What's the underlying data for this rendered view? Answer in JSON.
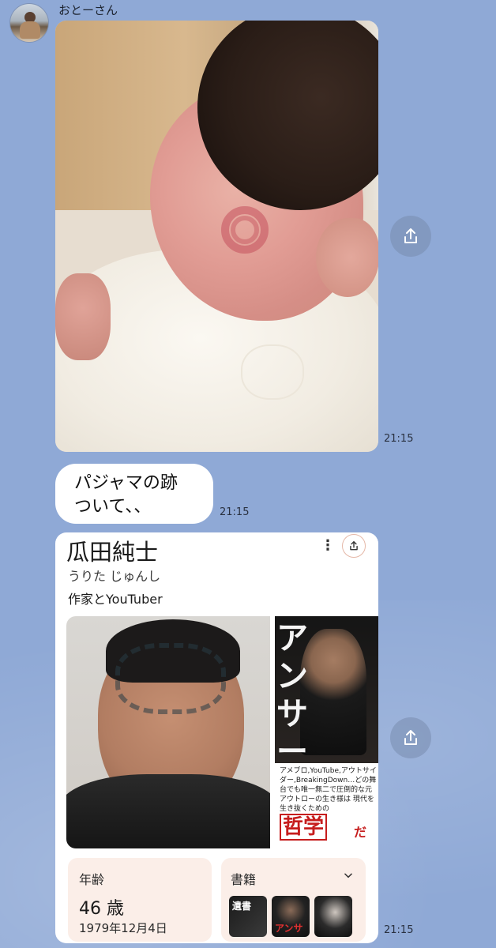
{
  "chat": {
    "sender_name": "おとーさん",
    "messages": [
      {
        "type": "image",
        "time": "21:15"
      },
      {
        "type": "text",
        "lines": [
          "パジャマの跡",
          "ついて、、"
        ],
        "time": "21:15"
      },
      {
        "type": "image",
        "time": "21:15"
      }
    ]
  },
  "card": {
    "name": "瓜田純士",
    "reading": "うりた じゅんし",
    "occupation": "作家とYouTuber",
    "menu_icon": "⋮",
    "book_cover_text": {
      "big_title": "アンサー",
      "blurb": "アメブロ,YouTube,アウトサイダー,BreakingDown…どの舞台でも唯一無二で圧倒的な元アウトローの生き様は",
      "line": "現代を生き抜くための",
      "highlight": "哲学",
      "suffix": "だ"
    },
    "age_label": "年齢",
    "age_value": "46 歳",
    "birthdate": "1979年12月4日",
    "books_label": "書籍",
    "book1_title": "遺書",
    "book2_title": "アンサ"
  },
  "icons": {
    "share": "share-icon",
    "chevron": "chevron-down-icon"
  },
  "colors": {
    "chat_background": "#8fa9d6",
    "bubble": "#ffffff",
    "info_tile": "#fbeee8"
  }
}
